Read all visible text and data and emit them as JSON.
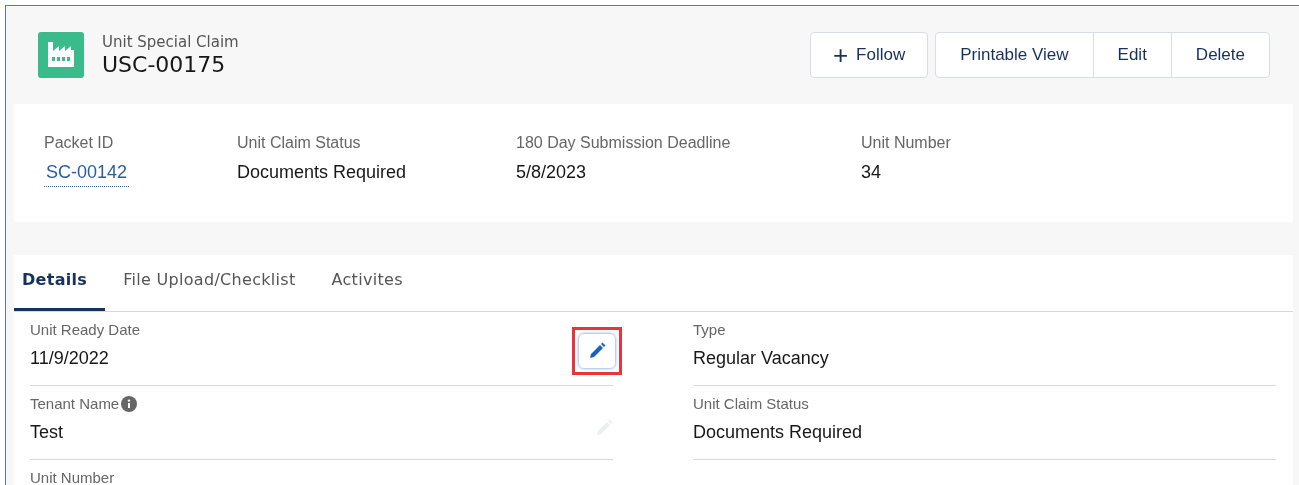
{
  "header": {
    "object_type": "Unit Special Claim",
    "record_name": "USC-00175",
    "follow_button": {
      "icon": "+",
      "label": "Follow"
    },
    "actions": [
      "Printable View",
      "Edit",
      "Delete"
    ]
  },
  "highlights": [
    {
      "label": "Packet ID",
      "value": "SC-00142",
      "kind": "link"
    },
    {
      "label": "Unit Claim Status",
      "value": "Documents Required",
      "kind": "text"
    },
    {
      "label": "180 Day Submission Deadline",
      "value": "5/8/2023",
      "kind": "text"
    },
    {
      "label": "Unit Number",
      "value": "34",
      "kind": "text"
    }
  ],
  "tabs": [
    {
      "label": "Details",
      "selected": true
    },
    {
      "label": "File Upload/Checklist",
      "selected": false
    },
    {
      "label": "Activites",
      "selected": false
    }
  ],
  "fields": [
    {
      "kind": "editable",
      "label": "Unit Ready Date",
      "value": "11/9/2022",
      "info": false,
      "edit_highlighted": true
    },
    {
      "kind": "readonly",
      "label": "Type",
      "value": "Regular Vacancy",
      "info": false
    },
    {
      "kind": "editable",
      "label": "Tenant Name",
      "value": "Test",
      "info": true,
      "edit_highlighted": false
    },
    {
      "kind": "readonly",
      "label": "Unit Claim Status",
      "value": "Documents Required",
      "info": false
    },
    {
      "kind": "partial",
      "label": "Unit Number",
      "info": false
    }
  ]
}
